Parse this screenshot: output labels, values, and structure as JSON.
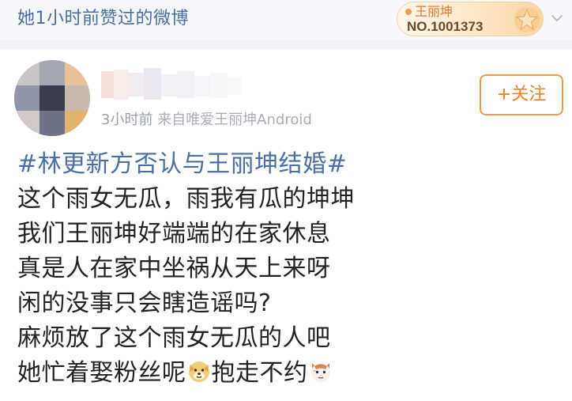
{
  "header": {
    "title": "她1小时前赞过的微博",
    "fan_badge": {
      "name": "王丽坤",
      "number": "NO.1001373"
    }
  },
  "post": {
    "meta": {
      "time": "3小时前",
      "source": "来自唯爱王丽坤Android"
    },
    "follow_label": "+关注",
    "topic": "#林更新方否认与王丽坤结婚#",
    "lines": [
      "这个雨女无瓜，雨我有瓜的坤坤",
      "我们王丽坤好端端的在家休息",
      "真是人在家中坐祸从天上来呀",
      "闲的没事只会瞎造谣吗?",
      "麻烦放了这个雨女无瓜的人吧"
    ],
    "last_line": {
      "part1": "她忙着娶粉丝呢",
      "emoji1": "dog-face-emoji",
      "part2": "抱走不约",
      "emoji2": "cat-face-emoji"
    }
  },
  "colors": {
    "link_blue": "#4a6fa8",
    "follow_orange": "#f07f22",
    "meta_gray": "#9aa0a8",
    "text": "#222222"
  }
}
